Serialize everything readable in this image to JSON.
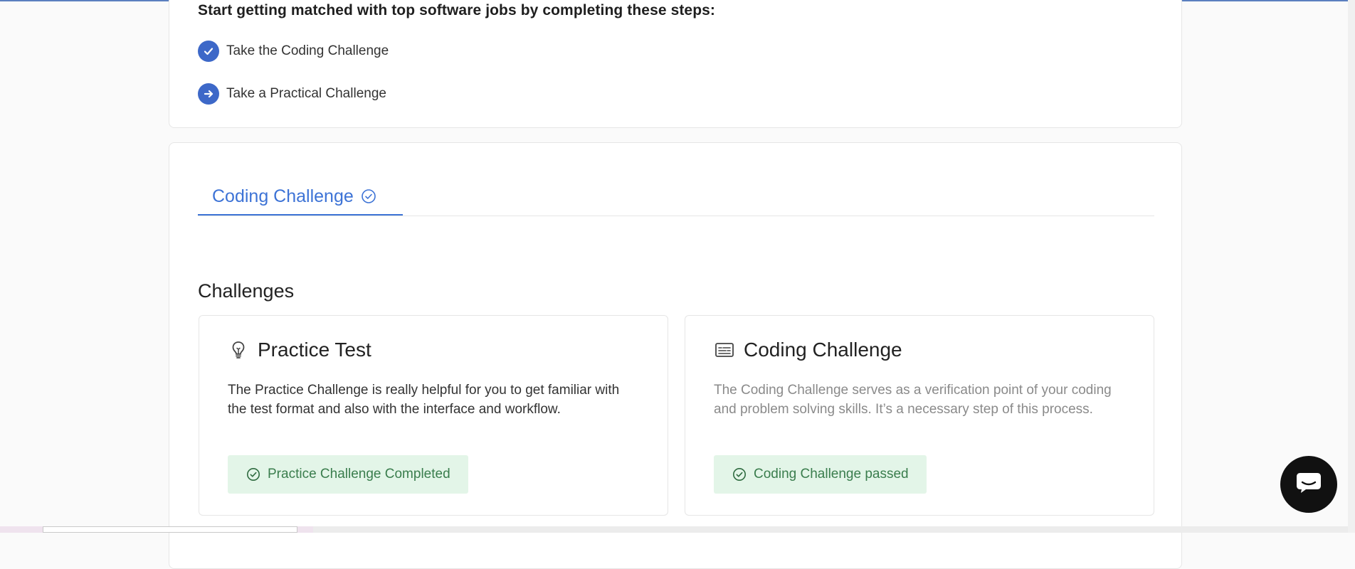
{
  "steps": {
    "title": "Start getting matched with top software jobs by completing these steps:",
    "items": [
      {
        "label": "Take the Coding Challenge",
        "icon": "check-icon",
        "state": "completed"
      },
      {
        "label": "Take a Practical Challenge",
        "icon": "arrow-right-icon",
        "state": "current"
      }
    ]
  },
  "tabs": [
    {
      "label": "Coding Challenge",
      "icon": "check-circle-icon",
      "active": true
    }
  ],
  "challenges": {
    "title": "Challenges",
    "cards": [
      {
        "icon": "lightbulb-icon",
        "title": "Practice Test",
        "description": "The Practice Challenge is really helpful for you to get familiar with the test format and also with the interface and workflow.",
        "status": "Practice Challenge Completed",
        "status_icon": "check-circle-icon"
      },
      {
        "icon": "terminal-icon",
        "title": "Coding Challenge",
        "description": "The Coding Challenge serves as a verification point of your coding and problem solving skills. It’s a necessary step of this process.",
        "status": "Coding Challenge passed",
        "status_icon": "check-circle-icon"
      }
    ]
  },
  "chat_widget": {
    "icon": "chat-bubble-icon"
  },
  "colors": {
    "accent": "#3d73d6",
    "step_icon_bg": "#3d68c8",
    "status_bg": "#e3f5e8",
    "status_text": "#3a7d4d"
  }
}
